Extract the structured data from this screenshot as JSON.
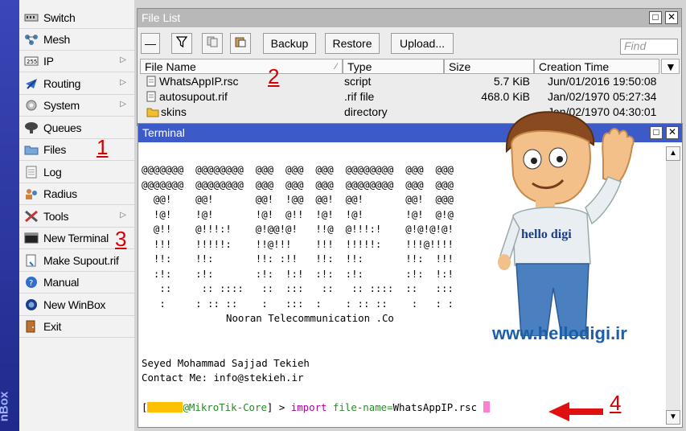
{
  "brand": {
    "text": "nBox"
  },
  "sidebar": {
    "items": [
      {
        "label": "Switch",
        "icon": "switch-icon",
        "arrow": false
      },
      {
        "label": "Mesh",
        "icon": "mesh-icon",
        "arrow": false
      },
      {
        "label": "IP",
        "icon": "ip-icon",
        "arrow": true
      },
      {
        "label": "Routing",
        "icon": "routing-icon",
        "arrow": true
      },
      {
        "label": "System",
        "icon": "system-gear-icon",
        "arrow": true
      },
      {
        "label": "Queues",
        "icon": "queues-icon",
        "arrow": false
      },
      {
        "label": "Files",
        "icon": "folder-icon",
        "arrow": false
      },
      {
        "label": "Log",
        "icon": "log-icon",
        "arrow": false
      },
      {
        "label": "Radius",
        "icon": "radius-icon",
        "arrow": false
      },
      {
        "label": "Tools",
        "icon": "tools-icon",
        "arrow": true
      },
      {
        "label": "New Terminal",
        "icon": "terminal-icon",
        "arrow": false
      },
      {
        "label": "Make Supout.rif",
        "icon": "supout-icon",
        "arrow": false
      },
      {
        "label": "Manual",
        "icon": "help-icon",
        "arrow": false
      },
      {
        "label": "New WinBox",
        "icon": "winbox-icon",
        "arrow": false
      },
      {
        "label": "Exit",
        "icon": "exit-icon",
        "arrow": false
      }
    ]
  },
  "annotations": {
    "one": "1",
    "two": "2",
    "three": "3",
    "four": "4"
  },
  "file_list": {
    "title": "File List",
    "toolbar": {
      "backup": "Backup",
      "restore": "Restore",
      "upload": "Upload...",
      "find_placeholder": "Find"
    },
    "columns": [
      "File Name",
      "Type",
      "Size",
      "Creation Time"
    ],
    "rows": [
      {
        "name": "WhatsAppIP.rsc",
        "type": "script",
        "size": "5.7 KiB",
        "time": "Jun/01/2016 19:50:08",
        "icon": "file-icon"
      },
      {
        "name": "autosupout.rif",
        "type": ".rif file",
        "size": "468.0 KiB",
        "time": "Jan/02/1970 05:27:34",
        "icon": "file-icon"
      },
      {
        "name": "skins",
        "type": "directory",
        "size": "",
        "time": "Jan/02/1970 04:30:01",
        "icon": "folder-icon"
      }
    ]
  },
  "terminal": {
    "title": "Terminal",
    "banner": [
      "@@@@@@@  @@@@@@@@  @@@  @@@  @@@  @@@@@@@@  @@@  @@@",
      "@@@@@@@  @@@@@@@@  @@@  @@@  @@@  @@@@@@@@  @@@  @@@",
      "  @@!    @@!       @@!  !@@  @@!  @@!       @@!  @@@",
      "  !@!    !@!       !@!  @!!  !@!  !@!       !@!  @!@",
      "  @!!    @!!!:!    @!@@!@!   !!@  @!!!:!    @!@!@!@!",
      "  !!!    !!!!!:    !!@!!!    !!!  !!!!!:    !!!@!!!!",
      "  !!:    !!:       !!: :!!   !!:  !!:       !!:  !!!",
      "  :!:    :!:       :!:  !:!  :!:  :!:       :!:  !:!",
      "   ::     :: ::::   ::  :::   ::   :: ::::  ::   :::",
      "   :     : :: ::    :   :::  :    : :: ::    :   : :"
    ],
    "company": "Nooran Telecommunication .Co",
    "author": "Seyed Mohammad Sajjad Tekieh",
    "contact": "Contact Me: info@stekieh.ir",
    "prompt_host": "@MikroTik-Core",
    "prompt_suffix": "] > ",
    "command_kw": "import",
    "command_arg": "file-name=",
    "command_value": "WhatsAppIP.rsc",
    "colors": {
      "host": "#228b22",
      "keyword": "#b0009e",
      "arg": "#2d8a2d",
      "redacted": "#ffc000",
      "cursor": "#ff7fd0"
    }
  },
  "mascot": {
    "shirt_text": "hello digi",
    "site": "www.hellodigi.ir"
  }
}
